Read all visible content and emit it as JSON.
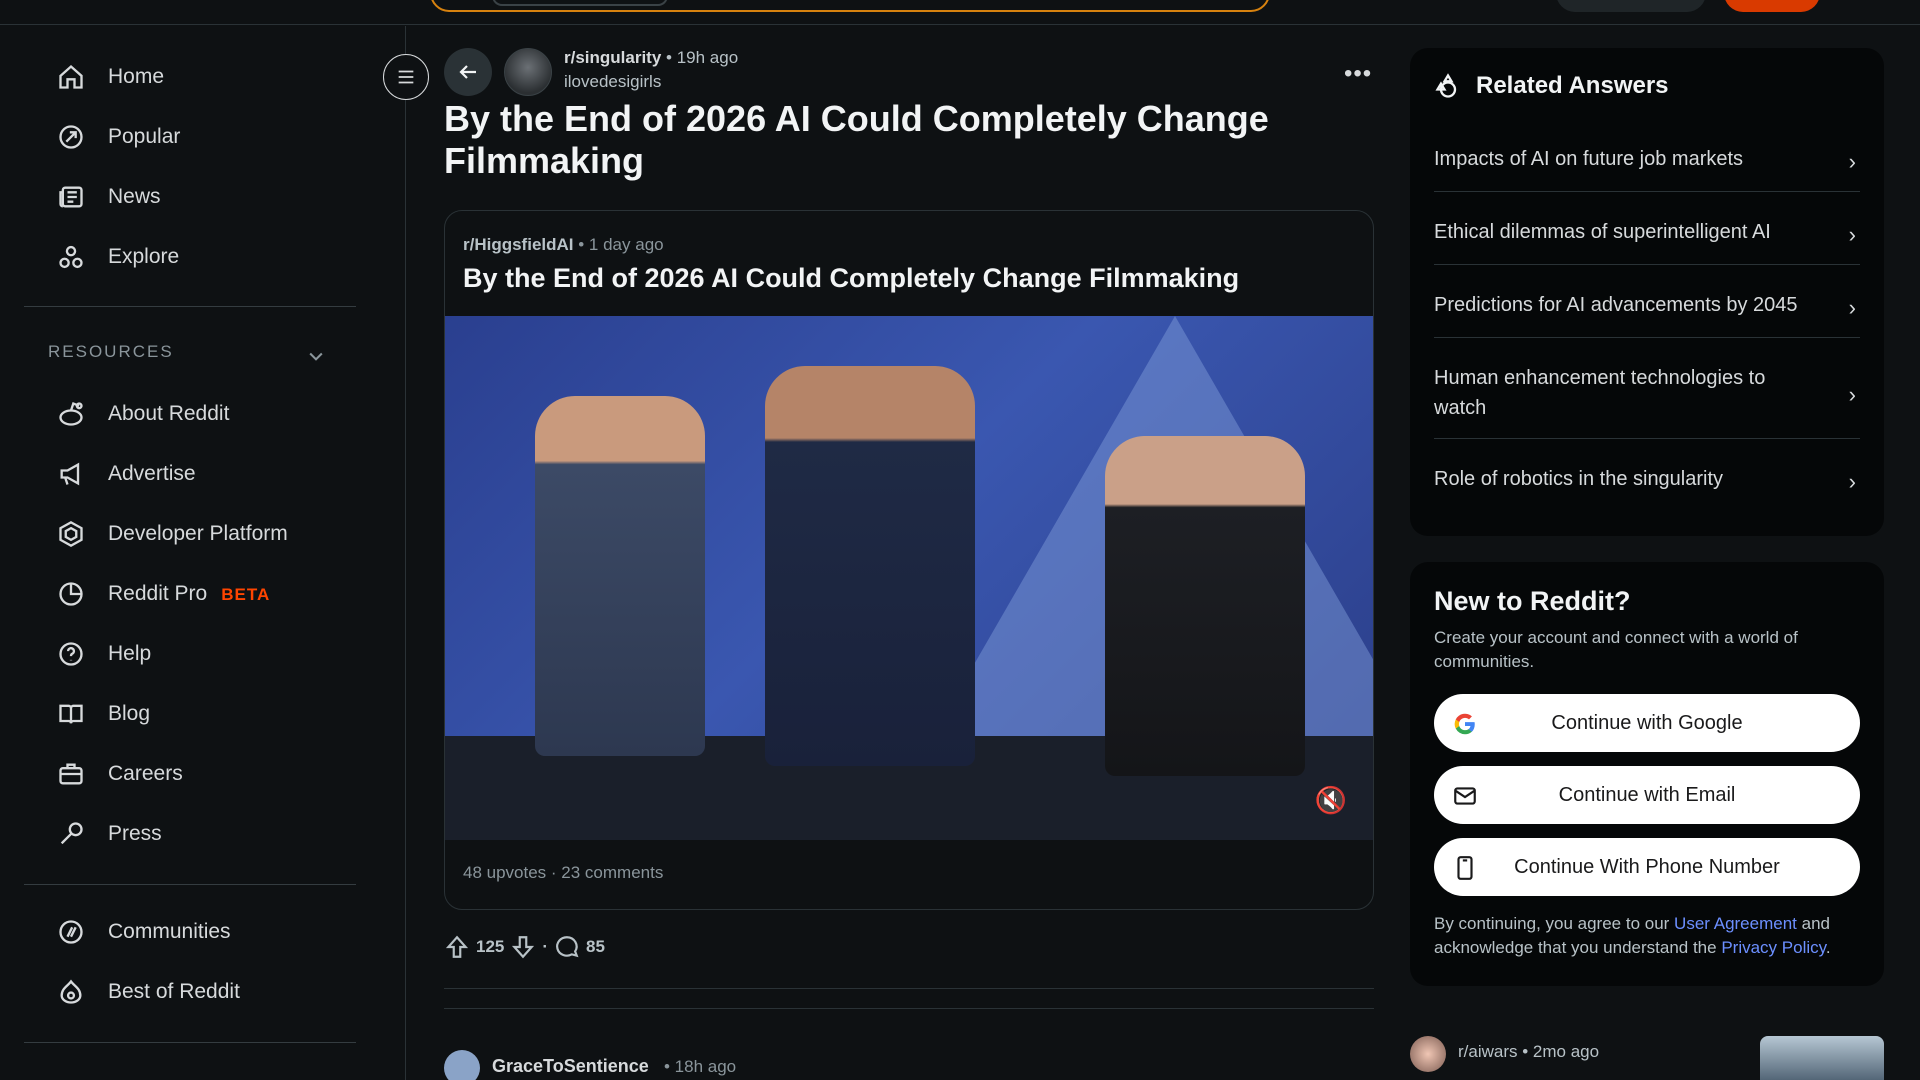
{
  "nav": {
    "items": [
      {
        "label": "Home",
        "icon": "home-icon"
      },
      {
        "label": "Popular",
        "icon": "popular-icon"
      },
      {
        "label": "News",
        "icon": "news-icon"
      },
      {
        "label": "Explore",
        "icon": "explore-icon"
      }
    ],
    "resources_label": "RESOURCES",
    "resources": [
      {
        "label": "About Reddit",
        "icon": "reddit-alien-icon"
      },
      {
        "label": "Advertise",
        "icon": "megaphone-icon"
      },
      {
        "label": "Developer Platform",
        "icon": "hexagon-icon"
      },
      {
        "label": "Reddit Pro",
        "icon": "pie-chart-icon",
        "badge": "BETA"
      },
      {
        "label": "Help",
        "icon": "help-icon"
      },
      {
        "label": "Blog",
        "icon": "book-icon"
      },
      {
        "label": "Careers",
        "icon": "briefcase-icon"
      },
      {
        "label": "Press",
        "icon": "microphone-icon"
      }
    ],
    "bottom": [
      {
        "label": "Communities",
        "icon": "communities-icon"
      },
      {
        "label": "Best of Reddit",
        "icon": "best-of-icon"
      }
    ]
  },
  "post": {
    "subreddit": "r/singularity",
    "time": "• 19h ago",
    "author": "ilovedesigirls",
    "title": "By the End of 2026 AI Could Completely Change Filmmaking",
    "crosspost": {
      "subreddit": "r/HiggsfieldAI",
      "time": "• 1 day ago",
      "title": "By the End of 2026 AI Could Completely Change Filmmaking",
      "stats": "48 upvotes · 23 comments"
    },
    "upvotes": "125",
    "comments": "85",
    "separator": "·"
  },
  "comment": {
    "author": "GraceToSentience",
    "time": "• 18h ago"
  },
  "related": {
    "title": "Related Answers",
    "items": [
      "Impacts of AI on future job markets",
      "Ethical dilemmas of superintelligent AI",
      "Predictions for AI advancements by 2045",
      "Human enhancement technologies to watch",
      "Role of robotics in the singularity"
    ]
  },
  "signup": {
    "title": "New to Reddit?",
    "subtitle": "Create your account and connect with a world of communities.",
    "google": "Continue with Google",
    "email": "Continue with Email",
    "phone": "Continue With Phone Number",
    "legal_pre": "By continuing, you agree to our ",
    "user_agreement": "User Agreement",
    "legal_mid": " and acknowledge that you understand the ",
    "privacy": "Privacy Policy",
    "legal_end": "."
  },
  "recommended": {
    "subreddit": "r/aiwars",
    "time": "• 2mo ago"
  },
  "colors": {
    "background": "#0e1113",
    "accent": "#ff4500",
    "link": "#6c8fff",
    "search_border": "#d7820f"
  }
}
